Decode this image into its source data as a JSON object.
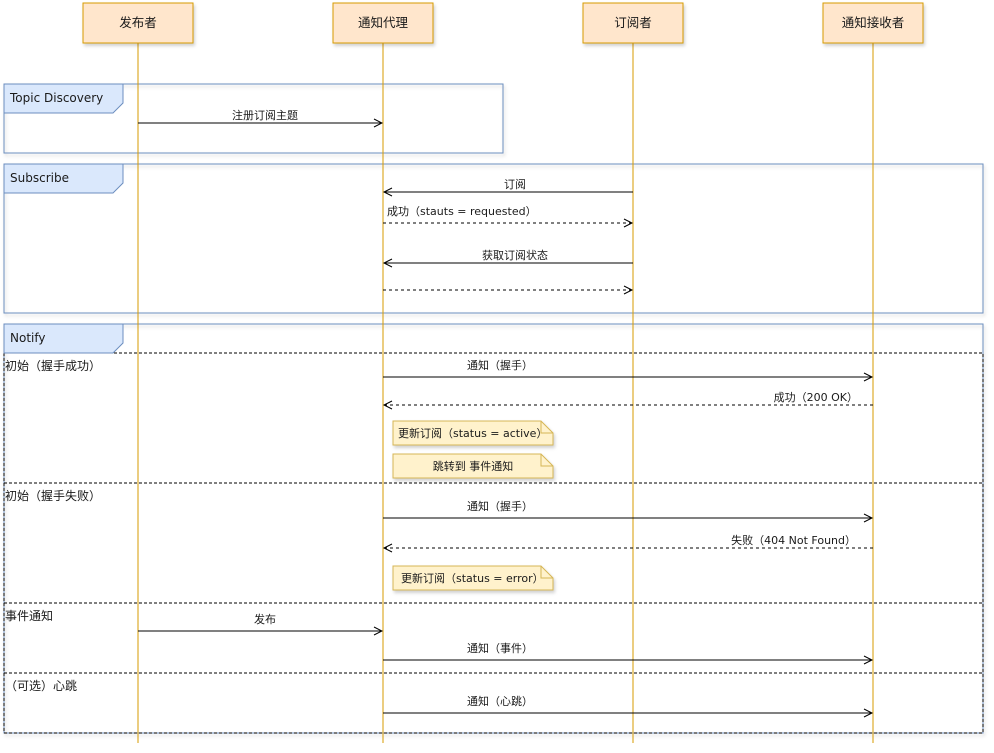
{
  "diagram": {
    "type": "sequence",
    "colors": {
      "actor_fill": "#ffe6cc",
      "actor_stroke": "#d79b00",
      "lifeline": "#d79b00",
      "frame_stroke": "#6c8ebf",
      "frame_tab_fill": "#dae8fc",
      "note_fill": "#fff2cc",
      "note_stroke": "#d6b656",
      "arrow": "#000000"
    },
    "actors": [
      {
        "id": "publisher",
        "label": "发布者"
      },
      {
        "id": "broker",
        "label": "通知代理"
      },
      {
        "id": "subscriber",
        "label": "订阅者"
      },
      {
        "id": "receiver",
        "label": "通知接收者"
      }
    ],
    "frames": [
      {
        "id": "topic-discovery",
        "label": "Topic Discovery"
      },
      {
        "id": "subscribe",
        "label": "Subscribe"
      },
      {
        "id": "notify",
        "label": "Notify",
        "sections": [
          {
            "label": "初始（握手成功）"
          },
          {
            "label": "初始（握手失败）"
          },
          {
            "label": "事件通知"
          },
          {
            "label": "（可选）心跳"
          }
        ]
      }
    ],
    "messages": [
      {
        "from": "publisher",
        "to": "broker",
        "label": "注册订阅主题",
        "style": "solid"
      },
      {
        "from": "subscriber",
        "to": "broker",
        "label": "订阅",
        "style": "solid"
      },
      {
        "from": "broker",
        "to": "subscriber",
        "label": "成功（stauts = requested）",
        "style": "dashed"
      },
      {
        "from": "subscriber",
        "to": "broker",
        "label": "获取订阅状态",
        "style": "solid"
      },
      {
        "from": "broker",
        "to": "subscriber",
        "label": "",
        "style": "dashed"
      },
      {
        "from": "broker",
        "to": "receiver",
        "label": "通知（握手）",
        "style": "solid"
      },
      {
        "from": "receiver",
        "to": "broker",
        "label": "成功（200 OK）",
        "style": "dashed"
      },
      {
        "from": "broker",
        "to": "receiver",
        "label": "通知（握手）",
        "style": "solid"
      },
      {
        "from": "receiver",
        "to": "broker",
        "label": "失败（404 Not Found）",
        "style": "dashed"
      },
      {
        "from": "publisher",
        "to": "broker",
        "label": "发布",
        "style": "solid"
      },
      {
        "from": "broker",
        "to": "receiver",
        "label": "通知（事件）",
        "style": "solid"
      },
      {
        "from": "broker",
        "to": "receiver",
        "label": "通知（心跳）",
        "style": "solid"
      }
    ],
    "notes": [
      {
        "label": "更新订阅（status = active）"
      },
      {
        "label": "跳转到 事件通知"
      },
      {
        "label": "更新订阅（status = error）"
      }
    ]
  }
}
